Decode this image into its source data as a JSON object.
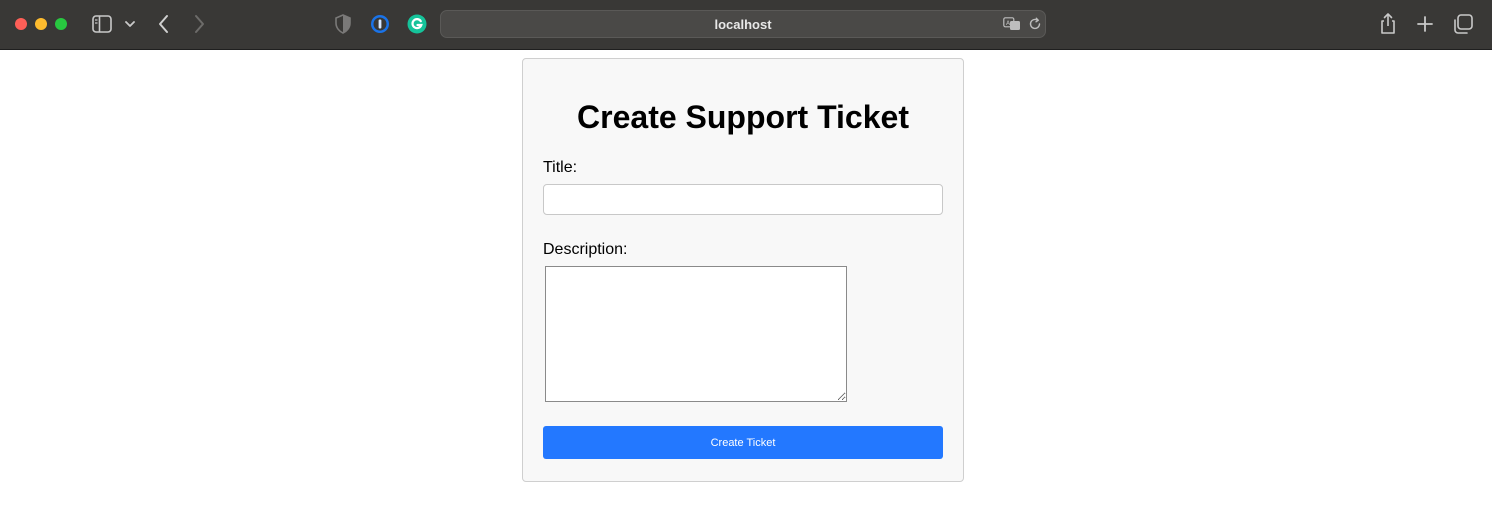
{
  "browser": {
    "url": "localhost"
  },
  "form": {
    "heading": "Create Support Ticket",
    "title_label": "Title:",
    "title_value": "",
    "description_label": "Description:",
    "description_value": "",
    "submit_label": "Create Ticket",
    "submit_color": "#2378ff"
  }
}
